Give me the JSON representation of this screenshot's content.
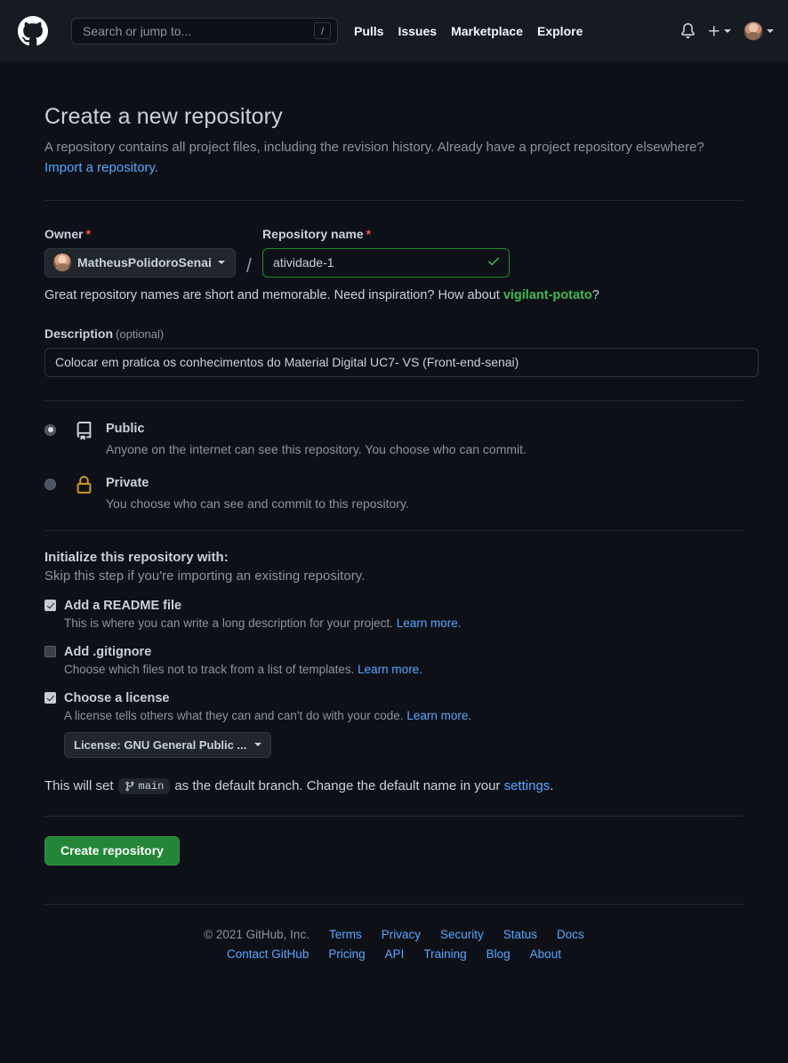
{
  "header": {
    "logo_icon": "github-mark-icon",
    "search": {
      "placeholder": "Search or jump to...",
      "shortcut_key": "/"
    },
    "nav": [
      {
        "label": "Pulls"
      },
      {
        "label": "Issues"
      },
      {
        "label": "Marketplace"
      },
      {
        "label": "Explore"
      }
    ],
    "notifications_icon": "bell-icon",
    "create_new_icon": "plus-icon",
    "account_icon": "avatar"
  },
  "main": {
    "title": "Create a new repository",
    "intro": "A repository contains all project files, including the revision history. Already have a project repository elsewhere?",
    "import_link": "Import a repository.",
    "owner": {
      "label": "Owner",
      "required_marker": "*",
      "value": "MatheusPolidoroSenai"
    },
    "separator": "/",
    "repo_name": {
      "label": "Repository name",
      "required_marker": "*",
      "value": "atividade-1",
      "placeholder": "",
      "valid_icon": "check-icon"
    },
    "name_hint": {
      "prefix": "Great repository names are short and memorable. Need inspiration? How about ",
      "suggestion": "vigilant-potato",
      "suffix": "?"
    },
    "description": {
      "label": "Description",
      "optional": "(optional)",
      "value": "Colocar em pratica os conhecimentos do Material Digital UC7- VS (Front-end-senai)",
      "placeholder": ""
    },
    "visibility": [
      {
        "id": "public",
        "icon": "repo-book-icon",
        "title": "Public",
        "description": "Anyone on the internet can see this repository. You choose who can commit.",
        "selected": true
      },
      {
        "id": "private",
        "icon": "lock-icon",
        "title": "Private",
        "description": "You choose who can see and commit to this repository.",
        "selected": false
      }
    ],
    "initialize": {
      "title": "Initialize this repository with:",
      "subtitle": "Skip this step if you're importing an existing repository.",
      "options": [
        {
          "id": "readme",
          "label": "Add a README file",
          "description": "This is where you can write a long description for your project.",
          "learn_more": "Learn more.",
          "checked": true
        },
        {
          "id": "gitignore",
          "label": "Add .gitignore",
          "description": "Choose which files not to track from a list of templates.",
          "learn_more": "Learn more.",
          "checked": false
        },
        {
          "id": "license",
          "label": "Choose a license",
          "description": "A license tells others what they can and can't do with your code.",
          "learn_more": "Learn more.",
          "checked": true
        }
      ],
      "license_select": "License: GNU General Public ..."
    },
    "branch_note": {
      "prefix": "This will set",
      "branch_icon": "git-branch-icon",
      "branch_name": "main",
      "middle": "as the default branch. Change the default name in your",
      "settings_link": "settings",
      "suffix": "."
    },
    "create_button": "Create repository"
  },
  "footer": {
    "copyright": "© 2021 GitHub, Inc.",
    "row1": [
      {
        "label": "Terms"
      },
      {
        "label": "Privacy"
      },
      {
        "label": "Security"
      },
      {
        "label": "Status"
      },
      {
        "label": "Docs"
      }
    ],
    "row2": [
      {
        "label": "Contact GitHub"
      },
      {
        "label": "Pricing"
      },
      {
        "label": "API"
      },
      {
        "label": "Training"
      },
      {
        "label": "Blog"
      },
      {
        "label": "About"
      }
    ]
  },
  "colors": {
    "background": "#0d1117",
    "header_bg": "#161b22",
    "accent_link": "#58a6ff",
    "success_green": "#238636",
    "valid_green": "#3fb950",
    "required_red": "#f85149",
    "lock_yellow": "#d29922",
    "border": "#30363d"
  }
}
